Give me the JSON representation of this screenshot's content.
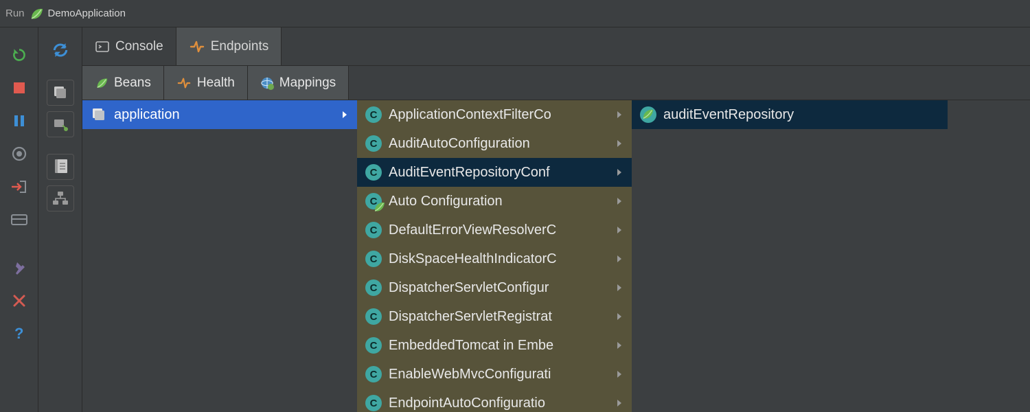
{
  "topbar": {
    "run_label": "Run",
    "app_name": "DemoApplication"
  },
  "tabs_main": {
    "console": "Console",
    "endpoints": "Endpoints"
  },
  "tabs_sub": {
    "beans": "Beans",
    "health": "Health",
    "mappings": "Mappings"
  },
  "column1": {
    "selected": "application"
  },
  "column2": [
    {
      "label": "ApplicationContextFilterCo",
      "kind": "class"
    },
    {
      "label": "AuditAutoConfiguration",
      "kind": "class"
    },
    {
      "label": "AuditEventRepositoryConf",
      "kind": "class",
      "selected": true
    },
    {
      "label": "Auto Configuration",
      "kind": "spring"
    },
    {
      "label": "DefaultErrorViewResolverC",
      "kind": "class"
    },
    {
      "label": "DiskSpaceHealthIndicatorC",
      "kind": "class"
    },
    {
      "label": "DispatcherServletConfigur",
      "kind": "class"
    },
    {
      "label": "DispatcherServletRegistrat",
      "kind": "class"
    },
    {
      "label": "EmbeddedTomcat in Embe",
      "kind": "class"
    },
    {
      "label": "EnableWebMvcConfigurati",
      "kind": "class"
    },
    {
      "label": "EndpointAutoConfiguratio",
      "kind": "class"
    }
  ],
  "column3": {
    "item": "auditEventRepository"
  }
}
